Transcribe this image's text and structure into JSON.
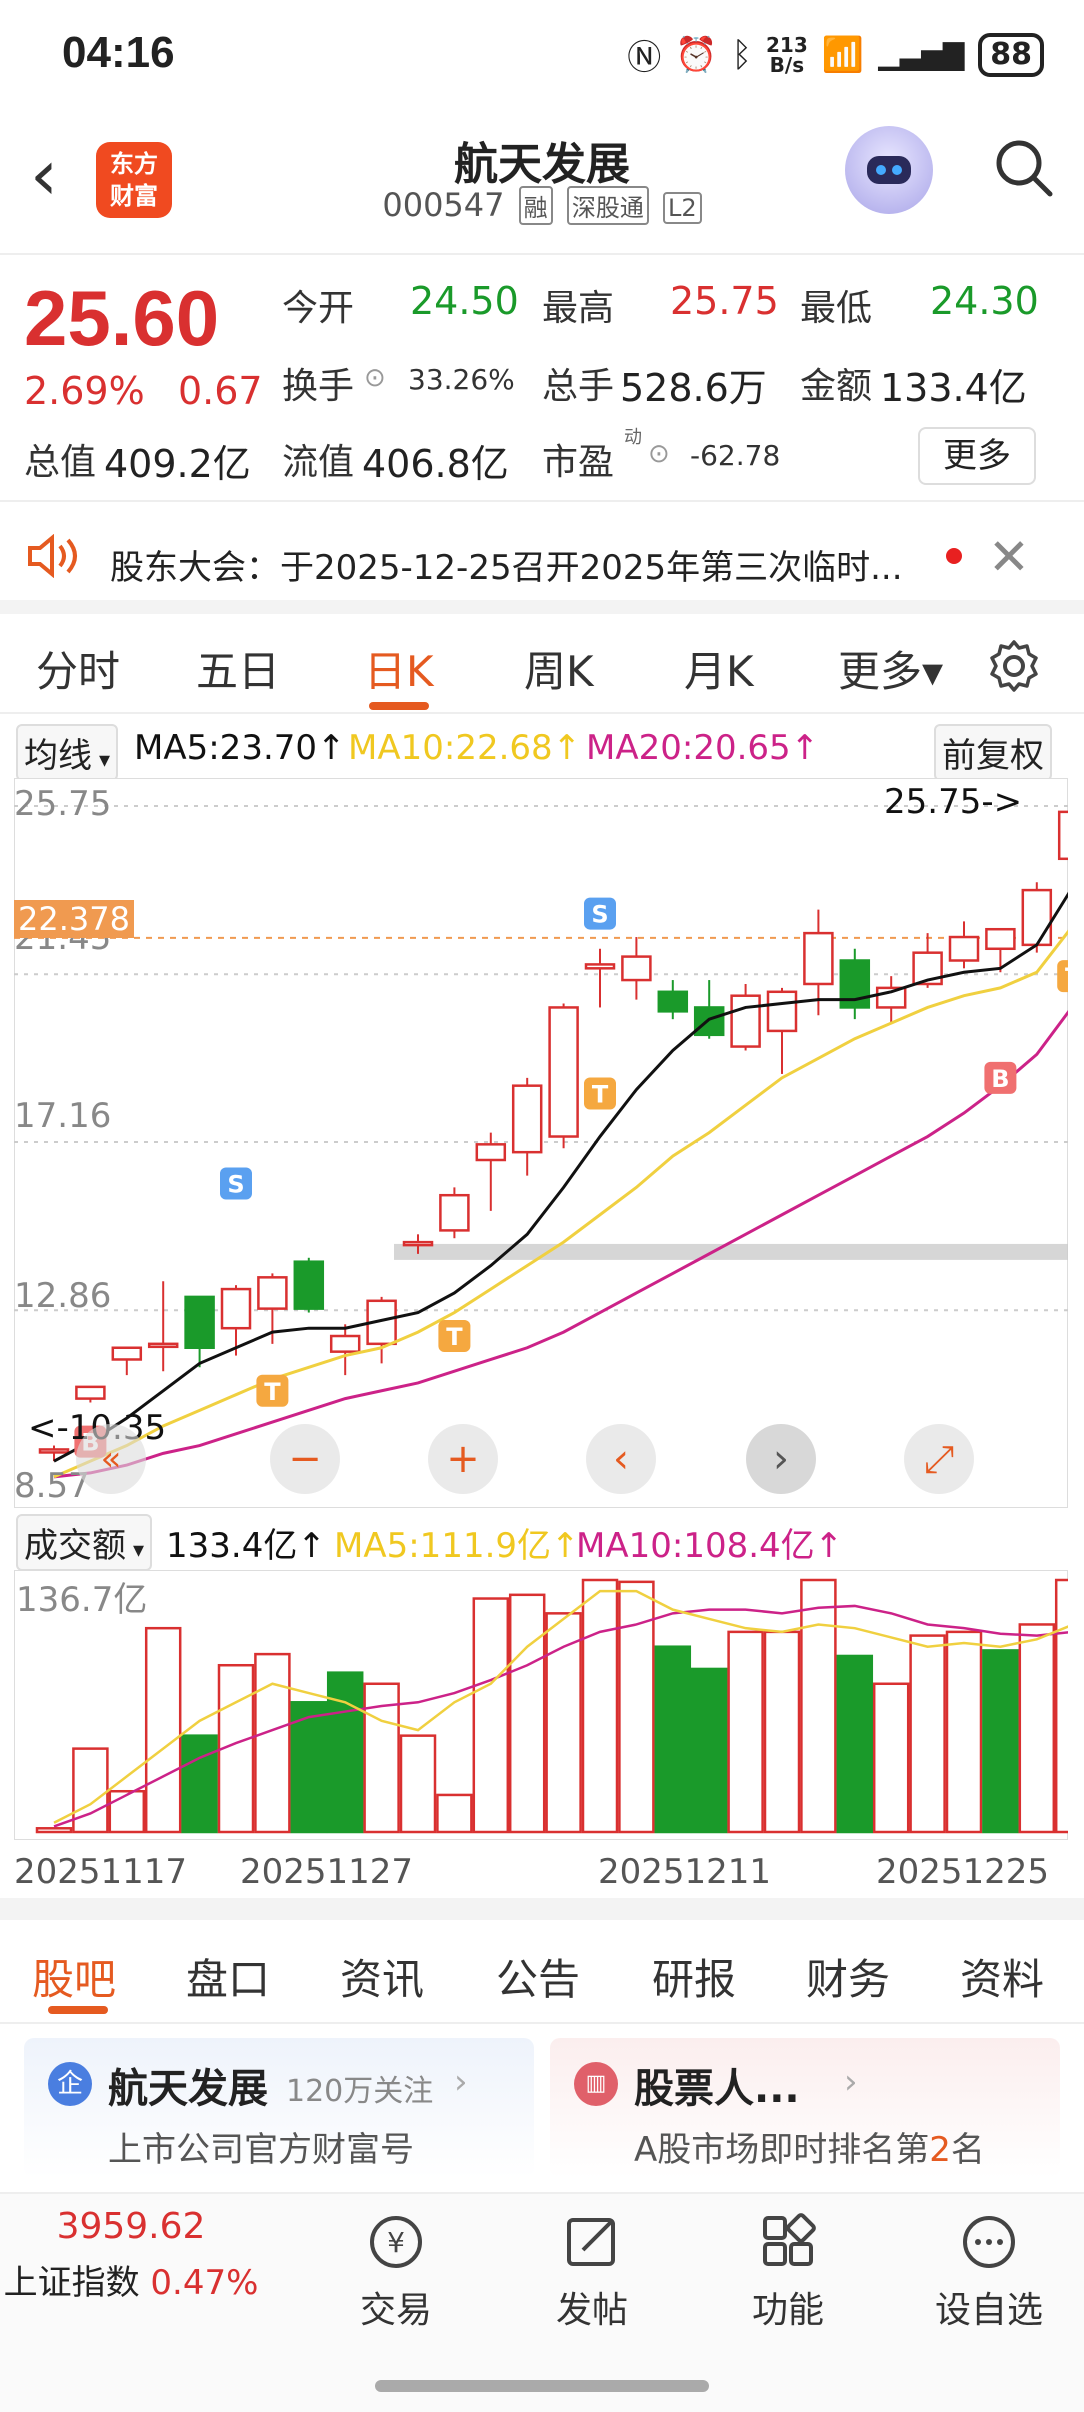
{
  "status": {
    "time": "04:16",
    "net_speed_top": "213",
    "net_speed_bottom": "B/s",
    "battery": "88"
  },
  "header": {
    "logo_line1": "东方",
    "logo_line2": "财富",
    "name": "航天发展",
    "code": "000547",
    "tags": [
      "融",
      "深股通",
      "L2"
    ]
  },
  "quote": {
    "price": "25.60",
    "change_pct": "2.69%",
    "change": "0.67",
    "open_label": "今开",
    "open": "24.50",
    "high_label": "最高",
    "high": "25.75",
    "low_label": "最低",
    "low": "24.30",
    "turnover_label": "换手",
    "turnover": "33.26%",
    "volume_label": "总手",
    "volume": "528.6万",
    "amount_label": "金额",
    "amount": "133.4亿",
    "mcap_label": "总值",
    "mcap": "409.2亿",
    "float_label": "流值",
    "float_cap": "406.8亿",
    "pe_label": "市盈",
    "pe_sup": "动",
    "pe": "-62.78",
    "more": "更多"
  },
  "notice": {
    "text": "股东大会：于2025-12-25召开2025年第三次临时..."
  },
  "ktabs": [
    "分时",
    "五日",
    "日K",
    "周K",
    "月K",
    "更多▾"
  ],
  "ma": {
    "selector": "均线",
    "ma5": "MA5:23.70",
    "ma10": "MA10:22.68",
    "ma20": "MA20:20.65",
    "adjust": "前复权",
    "arrow": "↑"
  },
  "colors": {
    "up": "#d93030",
    "down": "#1a9a2a",
    "ma5": "#111111",
    "ma10": "#f0d040",
    "ma20": "#cc2288",
    "accent": "#e55a20"
  },
  "chart_data": {
    "type": "candlestick",
    "y_ticks": [
      "25.75",
      "21.45",
      "17.16",
      "12.86",
      "8.57"
    ],
    "ylim": [
      8.57,
      25.75
    ],
    "ref_price_label": "22.378",
    "high_marker": "25.75->",
    "low_marker": "<-10.35",
    "candles": [
      {
        "o": 9.3,
        "h": 9.4,
        "l": 9.0,
        "c": 9.3
      },
      {
        "o": 10.6,
        "h": 10.8,
        "l": 10.5,
        "c": 10.9
      },
      {
        "o": 11.6,
        "h": 11.8,
        "l": 11.2,
        "c": 11.9
      },
      {
        "o": 12.0,
        "h": 13.6,
        "l": 11.3,
        "c": 12.0
      },
      {
        "o": 13.2,
        "h": 13.2,
        "l": 11.4,
        "c": 11.9
      },
      {
        "o": 12.4,
        "h": 13.5,
        "l": 11.7,
        "c": 13.4
      },
      {
        "o": 12.9,
        "h": 13.8,
        "l": 12.0,
        "c": 13.7
      },
      {
        "o": 14.1,
        "h": 14.2,
        "l": 12.8,
        "c": 12.9
      },
      {
        "o": 11.8,
        "h": 12.5,
        "l": 11.2,
        "c": 12.2
      },
      {
        "o": 12.0,
        "h": 13.2,
        "l": 11.5,
        "c": 13.1
      },
      {
        "o": 14.6,
        "h": 14.8,
        "l": 14.3,
        "c": 14.6
      },
      {
        "o": 14.9,
        "h": 16.0,
        "l": 14.7,
        "c": 15.8
      },
      {
        "o": 16.7,
        "h": 17.4,
        "l": 15.4,
        "c": 17.1
      },
      {
        "o": 16.9,
        "h": 18.8,
        "l": 16.3,
        "c": 18.6
      },
      {
        "o": 17.3,
        "h": 20.7,
        "l": 17.0,
        "c": 20.6
      },
      {
        "o": 21.6,
        "h": 22.1,
        "l": 20.6,
        "c": 21.7
      },
      {
        "o": 21.3,
        "h": 22.4,
        "l": 20.8,
        "c": 21.9
      },
      {
        "o": 21.0,
        "h": 21.3,
        "l": 20.3,
        "c": 20.5
      },
      {
        "o": 20.6,
        "h": 21.3,
        "l": 19.8,
        "c": 19.9
      },
      {
        "o": 19.6,
        "h": 21.2,
        "l": 19.5,
        "c": 20.9
      },
      {
        "o": 20.0,
        "h": 21.1,
        "l": 18.9,
        "c": 21.0
      },
      {
        "o": 21.2,
        "h": 23.1,
        "l": 20.4,
        "c": 22.5
      },
      {
        "o": 21.8,
        "h": 22.1,
        "l": 20.3,
        "c": 20.6
      },
      {
        "o": 20.6,
        "h": 21.4,
        "l": 20.2,
        "c": 21.1
      },
      {
        "o": 21.2,
        "h": 22.5,
        "l": 21.1,
        "c": 22.0
      },
      {
        "o": 21.8,
        "h": 22.8,
        "l": 21.6,
        "c": 22.4
      },
      {
        "o": 22.1,
        "h": 22.6,
        "l": 21.5,
        "c": 22.6
      },
      {
        "o": 22.2,
        "h": 23.8,
        "l": 22.0,
        "c": 23.6
      },
      {
        "o": 24.4,
        "h": 25.8,
        "l": 24.2,
        "c": 25.6
      }
    ],
    "ma5": [
      9.0,
      9.5,
      10.1,
      10.8,
      11.5,
      11.9,
      12.3,
      12.4,
      12.4,
      12.6,
      12.8,
      13.3,
      14.0,
      14.8,
      16.0,
      17.3,
      18.5,
      19.5,
      20.3,
      20.6,
      20.7,
      20.8,
      20.8,
      21.0,
      21.3,
      21.5,
      21.6,
      22.2,
      23.7
    ],
    "ma10": [
      8.6,
      9.0,
      9.4,
      9.9,
      10.3,
      10.7,
      11.1,
      11.4,
      11.7,
      11.9,
      12.3,
      12.8,
      13.4,
      14.0,
      14.6,
      15.3,
      16.0,
      16.8,
      17.4,
      18.1,
      18.8,
      19.3,
      19.8,
      20.2,
      20.6,
      20.9,
      21.1,
      21.5,
      22.7
    ],
    "ma20": [
      8.6,
      8.7,
      8.9,
      9.2,
      9.4,
      9.7,
      10.0,
      10.3,
      10.6,
      10.8,
      11.0,
      11.3,
      11.6,
      11.9,
      12.3,
      12.8,
      13.3,
      13.8,
      14.3,
      14.8,
      15.3,
      15.8,
      16.3,
      16.8,
      17.3,
      17.9,
      18.6,
      19.4,
      20.65
    ],
    "signals": [
      "B",
      "S",
      "T",
      "S",
      "T",
      "T",
      "B",
      "T"
    ],
    "volume": {
      "label": "成交额",
      "current": "133.4亿",
      "ma5": "MA5:111.9亿",
      "ma10": "MA10:108.4亿",
      "max_label": "136.7亿",
      "values": [
        2,
        45,
        22,
        110,
        52,
        90,
        96,
        70,
        86,
        80,
        52,
        20,
        126,
        128,
        118,
        136,
        135,
        100,
        88,
        108,
        108,
        136,
        95,
        80,
        106,
        108,
        98,
        112,
        136
      ],
      "down": [
        false,
        false,
        false,
        false,
        true,
        false,
        false,
        true,
        true,
        false,
        false,
        false,
        false,
        false,
        false,
        false,
        false,
        true,
        true,
        false,
        false,
        false,
        true,
        false,
        false,
        false,
        true,
        false,
        false
      ],
      "ma5_line": [
        5,
        15,
        30,
        45,
        60,
        70,
        80,
        75,
        70,
        60,
        55,
        70,
        80,
        100,
        115,
        130,
        130,
        120,
        115,
        110,
        108,
        112,
        110,
        105,
        100,
        102,
        100,
        104,
        112
      ],
      "ma10_line": [
        3,
        10,
        20,
        30,
        40,
        48,
        55,
        62,
        65,
        68,
        70,
        75,
        82,
        90,
        100,
        108,
        112,
        118,
        120,
        120,
        118,
        121,
        122,
        118,
        112,
        110,
        107,
        106,
        108
      ]
    },
    "x_labels": [
      "20251117",
      "20251127",
      "20251211",
      "20251225"
    ]
  },
  "chart_controls": [
    "«",
    "−",
    "+",
    "‹",
    "›",
    "⤢"
  ],
  "bottom_tabs": [
    "股吧",
    "盘口",
    "资讯",
    "公告",
    "研报",
    "财务",
    "资料"
  ],
  "cards": [
    {
      "badge": "企",
      "title": "航天发展",
      "follow": "120万关注",
      "sub": "上市公司官方财富号"
    },
    {
      "title": "股票人...",
      "sub_pre": "A股市场即时排名第",
      "rank": "2",
      "sub_post": "名"
    }
  ],
  "bottom_bar": {
    "index_value": "3959.62",
    "index_name": "上证指数",
    "index_pct": "0.47%",
    "items": [
      "交易",
      "发帖",
      "功能",
      "设自选"
    ]
  }
}
